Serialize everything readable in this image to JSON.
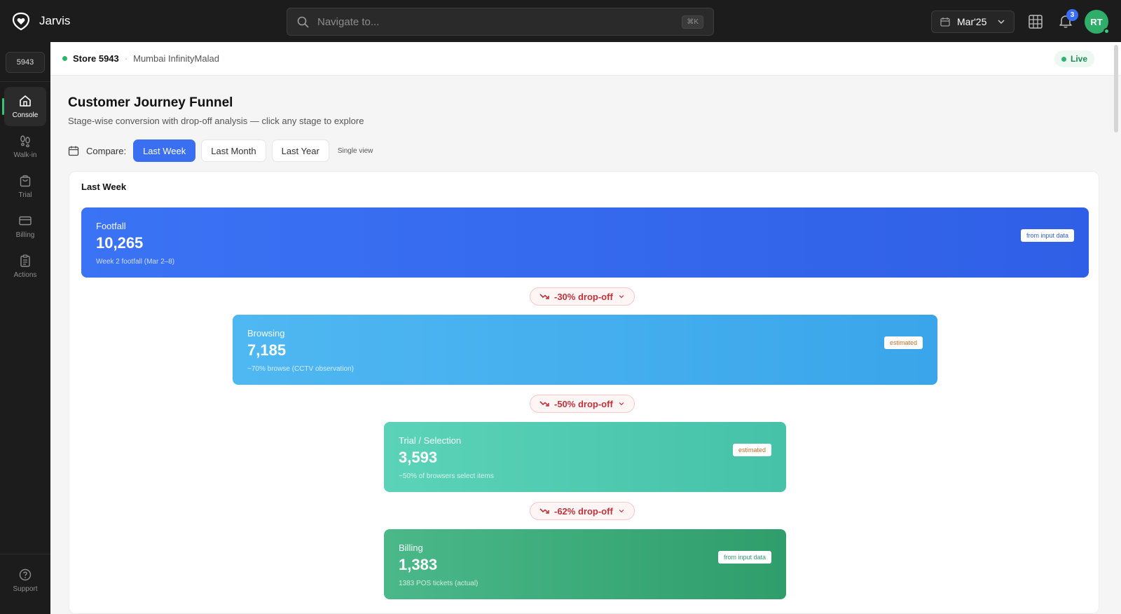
{
  "app": {
    "name": "Jarvis"
  },
  "search": {
    "placeholder": "Navigate to...",
    "shortcut": "⌘K"
  },
  "header": {
    "period_label": "Mar'25",
    "notifications_count": "3",
    "avatar_initials": "RT"
  },
  "sidebar": {
    "store_id": "5943",
    "items": [
      {
        "label": "Console",
        "icon": "home-icon",
        "active": true
      },
      {
        "label": "Walk-in",
        "icon": "footsteps-icon",
        "active": false
      },
      {
        "label": "Trial",
        "icon": "shopping-bag-icon",
        "active": false
      },
      {
        "label": "Billing",
        "icon": "credit-card-icon",
        "active": false
      },
      {
        "label": "Actions",
        "icon": "clipboard-icon",
        "active": false
      }
    ],
    "support_label": "Support"
  },
  "breadcrumb": {
    "store": "Store 5943",
    "separator": "·",
    "location": "Mumbai InfinityMalad",
    "status": "Live"
  },
  "page": {
    "title": "Customer Journey Funnel",
    "subtitle": "Stage-wise conversion with drop-off analysis — click any stage to explore",
    "compare_label": "Compare:",
    "compare_options": [
      "Last Week",
      "Last Month",
      "Last Year"
    ],
    "compare_selected": "Last Week",
    "single_view_label": "Single view"
  },
  "funnel": {
    "title": "Last Week",
    "stages": [
      {
        "name": "Footfall",
        "value": "10,265",
        "note": "Week 2 footfall (Mar 2–8)",
        "tag": "from input data"
      },
      {
        "name": "Browsing",
        "value": "7,185",
        "note": "~70% browse (CCTV observation)",
        "tag": "estimated"
      },
      {
        "name": "Trial / Selection",
        "value": "3,593",
        "note": "~50% of browsers select items",
        "tag": "estimated"
      },
      {
        "name": "Billing",
        "value": "1,383",
        "note": "1383 POS tickets (actual)",
        "tag": "from input data"
      }
    ],
    "dropoffs": [
      "-30% drop-off",
      "-50% drop-off",
      "-62% drop-off"
    ]
  },
  "colors": {
    "accent": "#3a6ff2",
    "live_green": "#2fb36d",
    "footfall": "#3b73f5",
    "browsing": "#4fb8f2",
    "trial": "#5bd3b8",
    "billing": "#3aa97a",
    "dropoff_red": "#c0323a"
  }
}
